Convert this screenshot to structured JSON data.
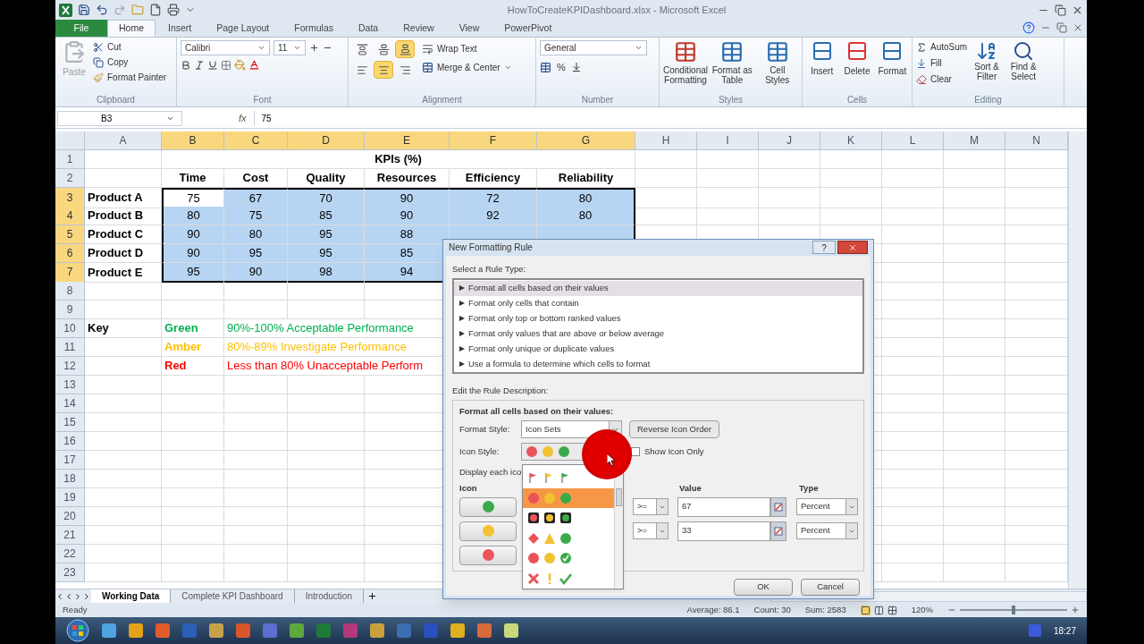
{
  "window": {
    "title": "HowToCreateKPIDashboard.xlsx - Microsoft Excel"
  },
  "ribbon_tabs": [
    {
      "label": "File",
      "kind": "file",
      "selected": false
    },
    {
      "label": "Home",
      "kind": "tab",
      "selected": true
    },
    {
      "label": "Insert",
      "kind": "tab",
      "selected": false
    },
    {
      "label": "Page Layout",
      "kind": "tab",
      "selected": false
    },
    {
      "label": "Formulas",
      "kind": "tab",
      "selected": false
    },
    {
      "label": "Data",
      "kind": "tab",
      "selected": false
    },
    {
      "label": "Review",
      "kind": "tab",
      "selected": false
    },
    {
      "label": "View",
      "kind": "tab",
      "selected": false
    },
    {
      "label": "PowerPivot",
      "kind": "tab",
      "selected": false
    }
  ],
  "ribbon": {
    "clipboard": {
      "label": "Clipboard",
      "paste": "Paste",
      "cut": "Cut",
      "copy": "Copy",
      "format_painter": "Format Painter"
    },
    "font": {
      "label": "Font",
      "family": "Calibri",
      "size": "11"
    },
    "alignment": {
      "label": "Alignment",
      "vertical": [
        {
          "selected": false
        },
        {
          "selected": false
        },
        {
          "selected": true
        }
      ],
      "horizontal": [
        {
          "selected": false
        },
        {
          "selected": true
        },
        {
          "selected": false
        }
      ],
      "wrap_text": "Wrap Text",
      "merge": "Merge & Center"
    },
    "number": {
      "label": "Number",
      "format": "General",
      "percent": "%"
    },
    "styles": {
      "label": "Styles",
      "buttons": [
        "Conditional Formatting",
        "Format as Table",
        "Cell Styles"
      ]
    },
    "cells": {
      "label": "Cells",
      "buttons": [
        "Insert",
        "Delete",
        "Format"
      ]
    },
    "editing": {
      "label": "Editing",
      "autosum": "AutoSum",
      "fill": "Fill",
      "clear": "Clear",
      "sort": "Sort & Filter",
      "find": "Find & Select"
    }
  },
  "formula_bar": {
    "name_box": "B3",
    "function_label": "fx",
    "formula": "75"
  },
  "sheet": {
    "columns": [
      {
        "label": "A",
        "selected": false
      },
      {
        "label": "B",
        "selected": true
      },
      {
        "label": "C",
        "selected": true
      },
      {
        "label": "D",
        "selected": true
      },
      {
        "label": "E",
        "selected": true
      },
      {
        "label": "F",
        "selected": true
      },
      {
        "label": "G",
        "selected": true
      },
      {
        "label": "H",
        "selected": false
      },
      {
        "label": "I",
        "selected": false
      },
      {
        "label": "J",
        "selected": false
      },
      {
        "label": "K",
        "selected": false
      },
      {
        "label": "L",
        "selected": false
      },
      {
        "label": "M",
        "selected": false
      },
      {
        "label": "N",
        "selected": false
      }
    ],
    "rows": [
      {
        "label": "1",
        "selected": false
      },
      {
        "label": "2",
        "selected": false
      },
      {
        "label": "3",
        "selected": true
      },
      {
        "label": "4",
        "selected": true
      },
      {
        "label": "5",
        "selected": true
      },
      {
        "label": "6",
        "selected": true
      },
      {
        "label": "7",
        "selected": true
      },
      {
        "label": "8",
        "selected": false
      },
      {
        "label": "9",
        "selected": false
      },
      {
        "label": "10",
        "selected": false
      },
      {
        "label": "11",
        "selected": false
      },
      {
        "label": "12",
        "selected": false
      },
      {
        "label": "13",
        "selected": false
      },
      {
        "label": "14",
        "selected": false
      },
      {
        "label": "15",
        "selected": false
      },
      {
        "label": "16",
        "selected": false
      },
      {
        "label": "17",
        "selected": false
      },
      {
        "label": "18",
        "selected": false
      },
      {
        "label": "19",
        "selected": false
      },
      {
        "label": "20",
        "selected": false
      },
      {
        "label": "21",
        "selected": false
      },
      {
        "label": "22",
        "selected": false
      },
      {
        "label": "23",
        "selected": false
      }
    ],
    "title": "KPIs (%)",
    "headers": [
      "Time",
      "Cost",
      "Quality",
      "Resources",
      "Efficiency",
      "Reliability"
    ],
    "products": [
      {
        "name": "Product A",
        "values": [
          {
            "text": "75",
            "active": true
          },
          {
            "text": "67",
            "active": false
          },
          {
            "text": "70",
            "active": false
          },
          {
            "text": "90",
            "active": false
          },
          {
            "text": "72",
            "active": false
          },
          {
            "text": "80",
            "active": false
          }
        ]
      },
      {
        "name": "Product B",
        "values": [
          {
            "text": "80",
            "active": false
          },
          {
            "text": "75",
            "active": false
          },
          {
            "text": "85",
            "active": false
          },
          {
            "text": "90",
            "active": false
          },
          {
            "text": "92",
            "active": false
          },
          {
            "text": "80",
            "active": false
          }
        ]
      },
      {
        "name": "Product C",
        "values": [
          {
            "text": "90",
            "active": false
          },
          {
            "text": "80",
            "active": false
          },
          {
            "text": "95",
            "active": false
          },
          {
            "text": "88",
            "active": false
          }
        ]
      },
      {
        "name": "Product D",
        "values": [
          {
            "text": "90",
            "active": false
          },
          {
            "text": "95",
            "active": false
          },
          {
            "text": "95",
            "active": false
          },
          {
            "text": "85",
            "active": false
          }
        ]
      },
      {
        "name": "Product E",
        "values": [
          {
            "text": "95",
            "active": false
          },
          {
            "text": "90",
            "active": false
          },
          {
            "text": "98",
            "active": false
          },
          {
            "text": "94",
            "active": false
          }
        ]
      }
    ],
    "key": {
      "label": "Key",
      "items": [
        {
          "name": "Green",
          "description": "90%-100% Acceptable Performance",
          "color": "#00b050"
        },
        {
          "name": "Amber",
          "description": "80%-89% Investigate Performance",
          "color": "#ffc000"
        },
        {
          "name": "Red",
          "description": "Less than 80% Unacceptable Perform",
          "color": "#ff0000"
        }
      ]
    }
  },
  "sheet_tabs": [
    {
      "label": "Working Data",
      "selected": true
    },
    {
      "label": "Complete KPI Dashboard",
      "selected": false
    },
    {
      "label": "Introduction",
      "selected": false
    }
  ],
  "status_bar": {
    "mode": "Ready",
    "average": "Average: 86.1",
    "count": "Count: 30",
    "sum": "Sum: 2583",
    "zoom": "120%",
    "zoom_slider": {
      "level": 0.5
    }
  },
  "taskbar": {
    "time": "18:27"
  },
  "dialog": {
    "title": "New Formatting Rule",
    "help": "?",
    "rule_type_label": "Select a Rule Type:",
    "rule_types": [
      {
        "label": "Format all cells based on their values",
        "selected": true
      },
      {
        "label": "Format only cells that contain",
        "selected": false
      },
      {
        "label": "Format only top or bottom ranked values",
        "selected": false
      },
      {
        "label": "Format only values that are above or below average",
        "selected": false
      },
      {
        "label": "Format only unique or duplicate values",
        "selected": false
      },
      {
        "label": "Use a formula to determine which cells to format",
        "selected": false
      }
    ],
    "description_label": "Edit the Rule Description:",
    "description_title": "Format all cells based on their values:",
    "format_style": {
      "label": "Format Style:",
      "value": "Icon Sets"
    },
    "reverse_button": "Reverse Icon Order",
    "icon_style": {
      "label": "Icon Style:",
      "kind": "circles"
    },
    "show_icon_only": {
      "label": "Show Icon Only",
      "checked": false
    },
    "display_text": "Display each ico",
    "columns": {
      "icon": "Icon",
      "value": "Value",
      "type": "Type"
    },
    "rules": [
      {
        "color": "#3caa4a",
        "operator": ">=",
        "value": "67",
        "type": "Percent"
      },
      {
        "color": "#f2c230",
        "operator": ">=",
        "value": "33",
        "type": "Percent"
      },
      {
        "color": "#e8545a"
      }
    ],
    "icon_style_options": [
      {
        "kind": "flags",
        "selected": false
      },
      {
        "kind": "circles",
        "selected": true
      },
      {
        "kind": "rimmed",
        "selected": false
      },
      {
        "kind": "shapes",
        "selected": false
      },
      {
        "kind": "circled-symbols",
        "selected": false
      },
      {
        "kind": "symbols",
        "selected": false
      }
    ],
    "buttons": [
      "OK",
      "Cancel"
    ]
  }
}
